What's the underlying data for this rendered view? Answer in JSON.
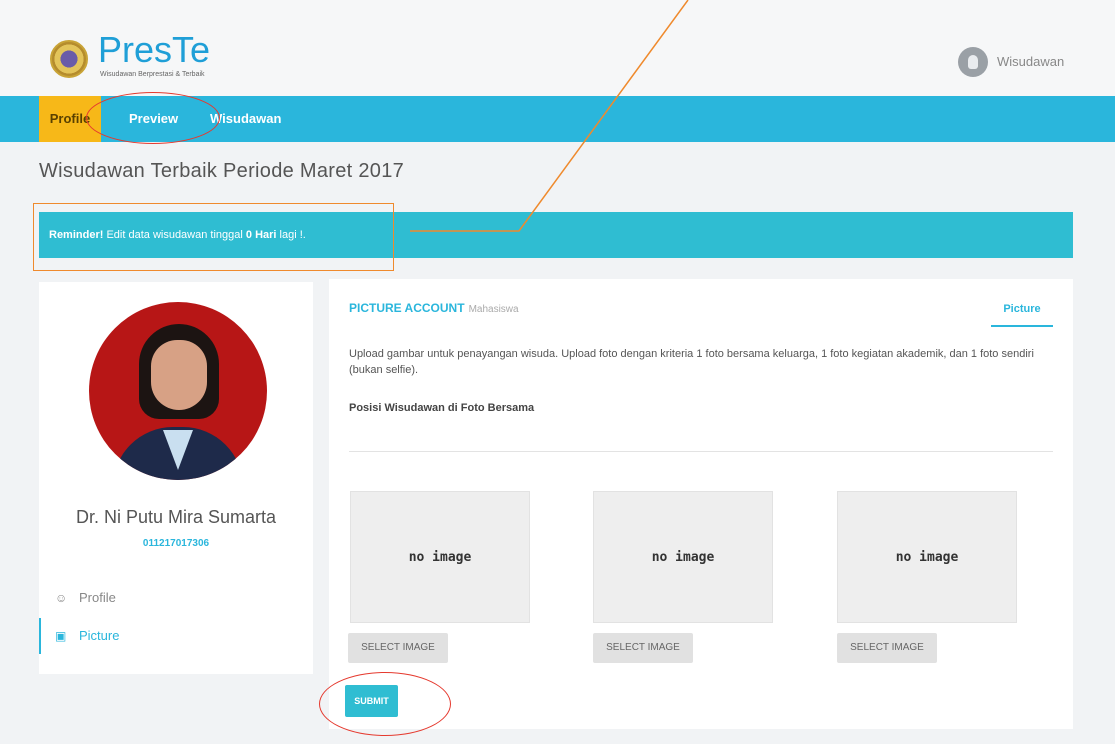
{
  "header": {
    "logo_text": "PresTe",
    "logo_subtitle": "Wisudawan Berprestasi & Terbaik",
    "user_label": "Wisudawan"
  },
  "nav": {
    "items": [
      {
        "label": "Profile"
      },
      {
        "label": "Preview"
      },
      {
        "label": "Wisudawan"
      }
    ],
    "active": "Profile"
  },
  "page": {
    "title": "Wisudawan Terbaik Periode Maret 2017"
  },
  "reminder": {
    "prefix": "Reminder!",
    "text": " Edit data wisudawan tinggal ",
    "days": "0 Hari",
    "suffix": " lagi !."
  },
  "profile": {
    "name": "Dr. Ni Putu Mira Sumarta",
    "nim": "011217017306",
    "menu": [
      {
        "label": "Profile",
        "icon": "user-icon"
      },
      {
        "label": "Picture",
        "icon": "image-icon"
      }
    ]
  },
  "card": {
    "title": "PICTURE ACCOUNT",
    "title_sub": "Mahasiswa",
    "tab": "Picture",
    "description": "Upload gambar untuk penayangan wisuda. Upload foto dengan kriteria 1 foto bersama keluarga, 1 foto kegiatan akademik, dan 1 foto sendiri (bukan selfie).",
    "subheading": "Posisi Wisudawan di Foto Bersama",
    "slots": [
      {
        "placeholder": "no image",
        "button": "SELECT IMAGE"
      },
      {
        "placeholder": "no image",
        "button": "SELECT IMAGE"
      },
      {
        "placeholder": "no image",
        "button": "SELECT IMAGE"
      }
    ],
    "submit_label": "SUBMIT"
  },
  "colors": {
    "primary": "#2ab6dc",
    "accent": "#f7b818",
    "annotation_red": "#e53a2f",
    "annotation_orange": "#ef8a2d"
  }
}
